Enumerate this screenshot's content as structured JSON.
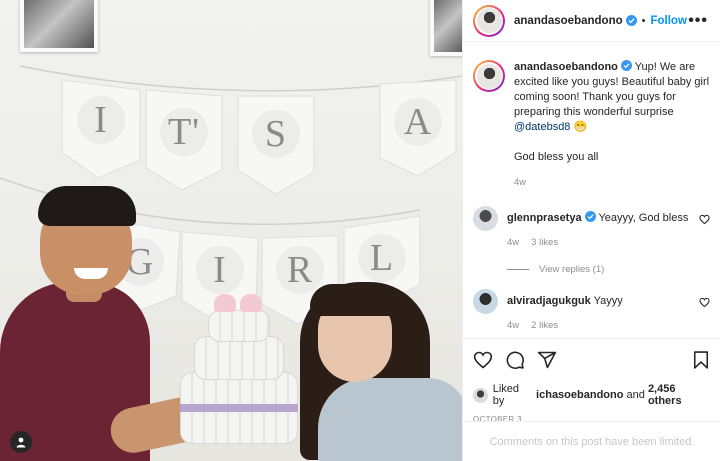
{
  "post": {
    "author": "anandasoebandono",
    "follow_label": "Follow",
    "more_label": "•••",
    "separator": "•"
  },
  "photo": {
    "banner_letters": [
      "I",
      "T'",
      "S",
      "A",
      "G",
      "I",
      "R",
      "L"
    ]
  },
  "caption": {
    "username": "anandasoebandono",
    "text_main": "Yup! We are excited like you guys! Beautiful baby girl coming soon! Thank you guys for preparing this wonderful surprise",
    "mention": "@datebsd8",
    "emoji": "😁",
    "text_second": "God bless you all",
    "time": "4w"
  },
  "comments": [
    {
      "username": "glennprasetya",
      "text": "Yeayyy, God bless",
      "time": "4w",
      "likes": "3 likes",
      "replies": "View replies (1)"
    },
    {
      "username": "alviradjagukguk",
      "text": "Yayyy",
      "time": "4w",
      "likes": "2 likes"
    }
  ],
  "likes": {
    "prefix": "Liked by",
    "user": "ichasoebandono",
    "and": "and",
    "others": "2,456 others"
  },
  "date": "OCTOBER 3",
  "footer": "Comments on this post have been limited.",
  "colors": {
    "link": "#0095f6",
    "verified": "#3897f0",
    "muted": "#8e8e8e",
    "shirt": "#6b2433"
  },
  "icons": [
    "heart-icon",
    "comment-icon",
    "share-icon",
    "bookmark-icon",
    "verified-badge-icon",
    "user-tag-icon"
  ]
}
